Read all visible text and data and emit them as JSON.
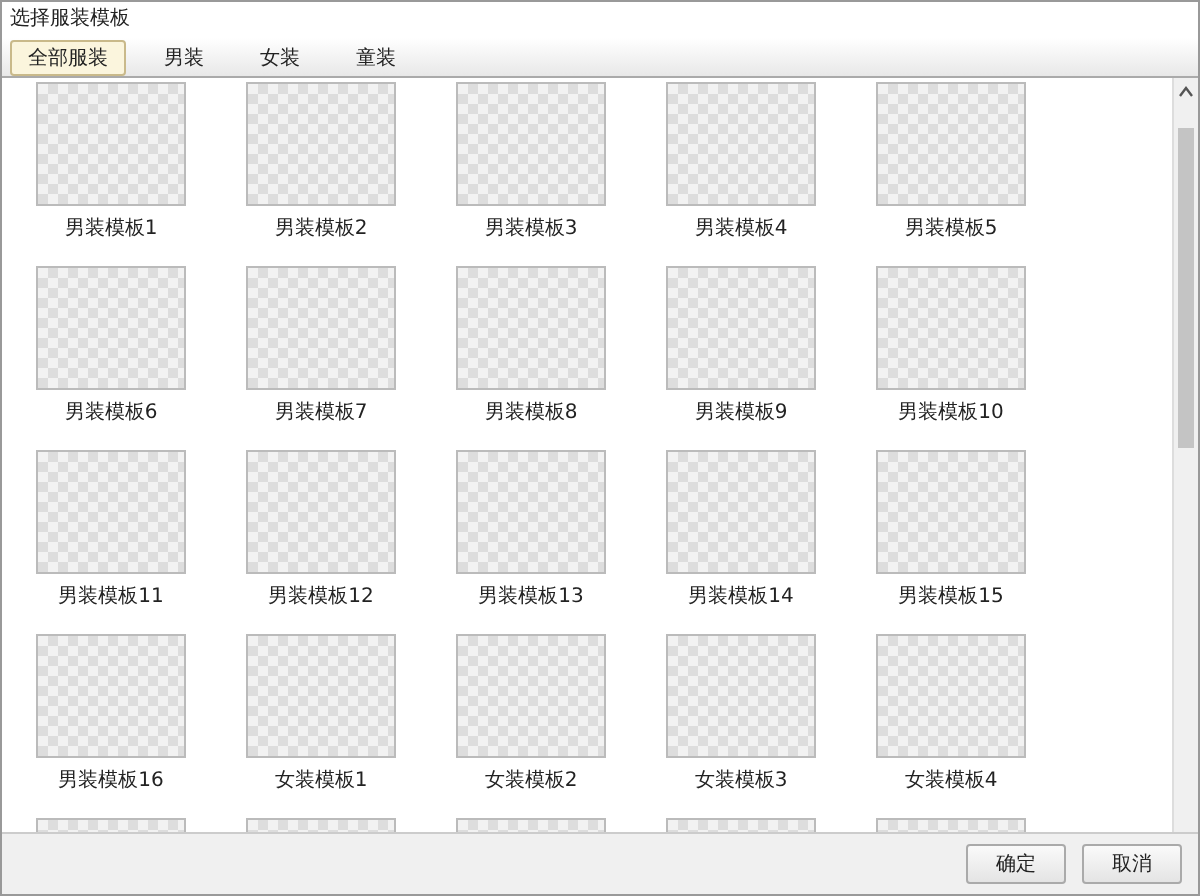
{
  "window": {
    "title": "选择服装模板"
  },
  "tabs": [
    {
      "label": "全部服装",
      "selected": true
    },
    {
      "label": "男装",
      "selected": false
    },
    {
      "label": "女装",
      "selected": false
    },
    {
      "label": "童装",
      "selected": false
    }
  ],
  "templates": [
    {
      "kind": "labeled",
      "label": "男装模板1"
    },
    {
      "kind": "labeled",
      "label": "男装模板2"
    },
    {
      "kind": "labeled",
      "label": "男装模板3"
    },
    {
      "kind": "labeled",
      "label": "男装模板4"
    },
    {
      "kind": "labeled",
      "label": "男装模板5"
    },
    {
      "kind": "labeled",
      "label": "男装模板6"
    },
    {
      "kind": "labeled",
      "label": "男装模板7"
    },
    {
      "kind": "labeled",
      "label": "男装模板8"
    },
    {
      "kind": "labeled",
      "label": "男装模板9"
    },
    {
      "kind": "labeled",
      "label": "男装模板10"
    },
    {
      "kind": "labeled",
      "label": "男装模板11"
    },
    {
      "kind": "labeled",
      "label": "男装模板12"
    },
    {
      "kind": "labeled",
      "label": "男装模板13"
    },
    {
      "kind": "labeled",
      "label": "男装模板14"
    },
    {
      "kind": "labeled",
      "label": "男装模板15"
    },
    {
      "kind": "labeled",
      "label": "男装模板16"
    },
    {
      "kind": "labeled",
      "label": "女装模板1"
    },
    {
      "kind": "labeled",
      "label": "女装模板2"
    },
    {
      "kind": "labeled",
      "label": "女装模板3"
    },
    {
      "kind": "labeled",
      "label": "女装模板4"
    },
    {
      "kind": "cut_off"
    },
    {
      "kind": "cut_off"
    },
    {
      "kind": "cut_off"
    },
    {
      "kind": "cut_off"
    },
    {
      "kind": "cut_off"
    }
  ],
  "buttons": [
    {
      "label": "确定"
    },
    {
      "label": "取消"
    }
  ]
}
